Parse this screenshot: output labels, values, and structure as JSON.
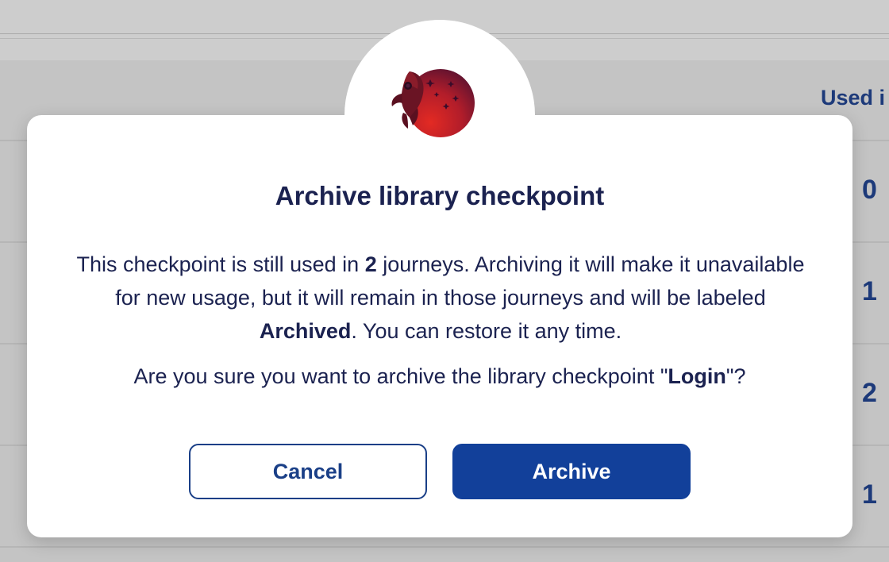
{
  "background": {
    "table_column_header": "Used i",
    "table_values": [
      "0",
      "1",
      "2",
      "1"
    ]
  },
  "dialog": {
    "logo_icon": "rocket-planet-logo-icon",
    "title": "Archive library checkpoint",
    "message": {
      "part1": "This checkpoint is still used in ",
      "count": "2",
      "part2": " journeys. Archiving it will make it unavailable for new usage, but it will remain in those journeys and will be labeled ",
      "label": "Archived",
      "part3": ". You can restore it any time."
    },
    "question": {
      "part1": "Are you sure you want to archive the library checkpoint \"",
      "name": "Login",
      "part2": "\"?"
    },
    "cancel_label": "Cancel",
    "archive_label": "Archive"
  },
  "colors": {
    "primary": "#12409a",
    "text": "#1b2250",
    "overlay": "#c4c4c4"
  }
}
